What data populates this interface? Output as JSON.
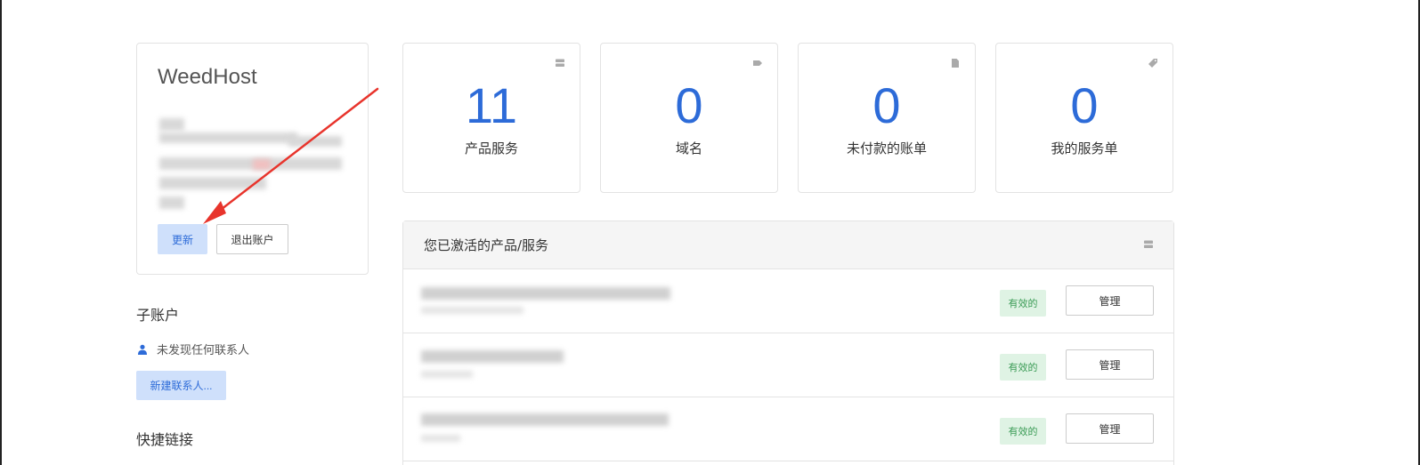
{
  "account": {
    "name": "WeedHost",
    "update_label": "更新",
    "logout_label": "退出账户"
  },
  "subaccounts": {
    "title": "子账户",
    "empty_text": "未发现任何联系人",
    "new_contact_label": "新建联系人..."
  },
  "quicklinks": {
    "title": "快捷链接"
  },
  "stats": [
    {
      "value": "11",
      "label": "产品服务",
      "icon": "server-icon"
    },
    {
      "value": "0",
      "label": "域名",
      "icon": "tag-icon"
    },
    {
      "value": "0",
      "label": "未付款的账单",
      "icon": "document-icon"
    },
    {
      "value": "0",
      "label": "我的服务单",
      "icon": "ticket-icon"
    }
  ],
  "services": {
    "title": "您已激活的产品/服务",
    "rows": [
      {
        "status": "有效的",
        "manage_label": "管理"
      },
      {
        "status": "有效的",
        "manage_label": "管理"
      },
      {
        "status": "有效的",
        "manage_label": "管理"
      }
    ]
  },
  "colors": {
    "accent": "#2d6bd8",
    "annotation_arrow": "#e8342c",
    "status_green": "#3a9b55"
  }
}
